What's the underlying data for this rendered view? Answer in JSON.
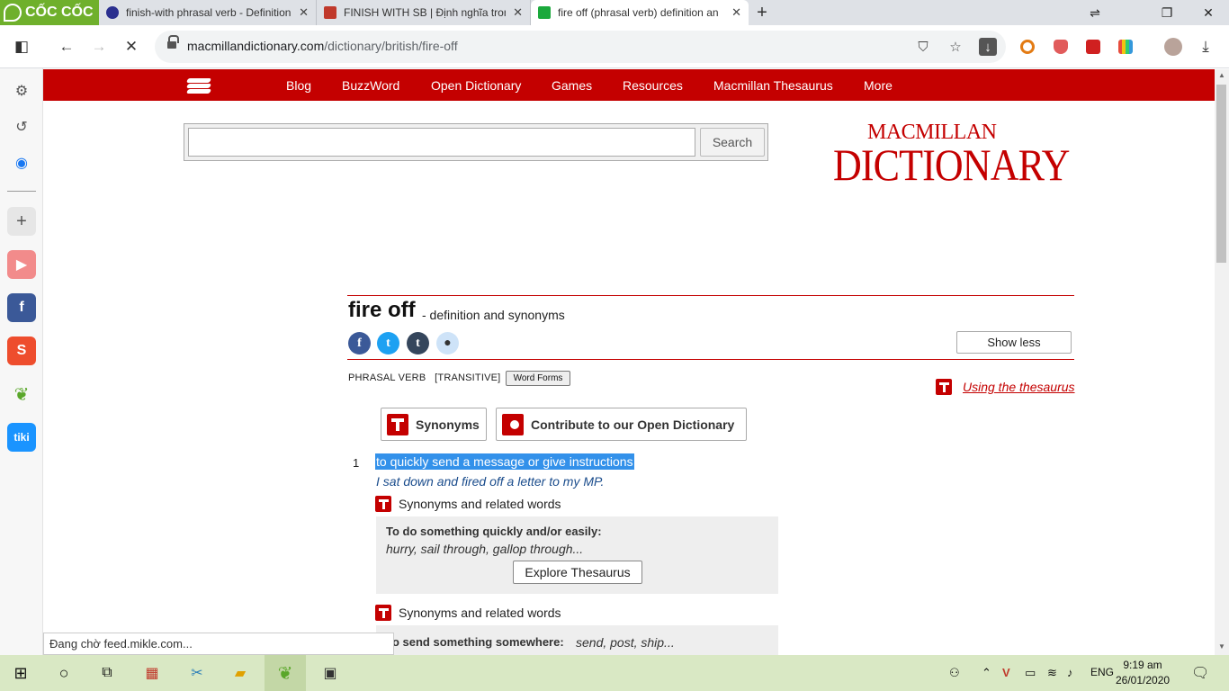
{
  "browser": {
    "brand": "CỐC CỐC",
    "tabs": [
      {
        "title": "finish-with phrasal verb - Definition",
        "active": false
      },
      {
        "title": "FINISH WITH SB | Định nghĩa trong",
        "active": false
      },
      {
        "title": "fire off (phrasal verb) definition an",
        "active": true
      }
    ],
    "url_domain": "macmillandictionary.com",
    "url_path": "/dictionary/british/fire-off"
  },
  "site": {
    "nav": [
      "Blog",
      "BuzzWord",
      "Open Dictionary",
      "Games",
      "Resources",
      "Macmillan Thesaurus",
      "More"
    ],
    "search_placeholder": "",
    "search_button": "Search",
    "brand_top": "MACMILLAN",
    "brand_bottom": "DICTIONARY"
  },
  "entry": {
    "headword": "fire off",
    "suffix": "- definition and synonyms",
    "show_less": "Show less",
    "part_of_speech": "PHRASAL VERB",
    "grammar": "[TRANSITIVE]",
    "word_forms": "Word Forms",
    "using_thesaurus": "Using the thesaurus",
    "synonyms_button": "Synonyms",
    "contribute_button": "Contribute to our Open Dictionary",
    "sense_number": "1",
    "definition": "to quickly send a message or give instructions",
    "example": "I sat down and fired off a letter to my MP.",
    "syn_groups": [
      {
        "heading": "Synonyms and related words",
        "title": "To do something quickly and/or easily:",
        "words": "hurry, sail through, gallop through...",
        "button": "Explore Thesaurus"
      },
      {
        "heading": "Synonyms and related words",
        "title": "To send something somewhere:",
        "words": "send, post, ship..."
      }
    ]
  },
  "status": "Đang chờ feed.mikle.com...",
  "taskbar": {
    "language": "ENG",
    "time": "9:19 am",
    "date": "26/01/2020"
  },
  "colors": {
    "brand_red": "#c40000",
    "selection": "#3391ea",
    "taskbar": "#d9e8c4"
  }
}
